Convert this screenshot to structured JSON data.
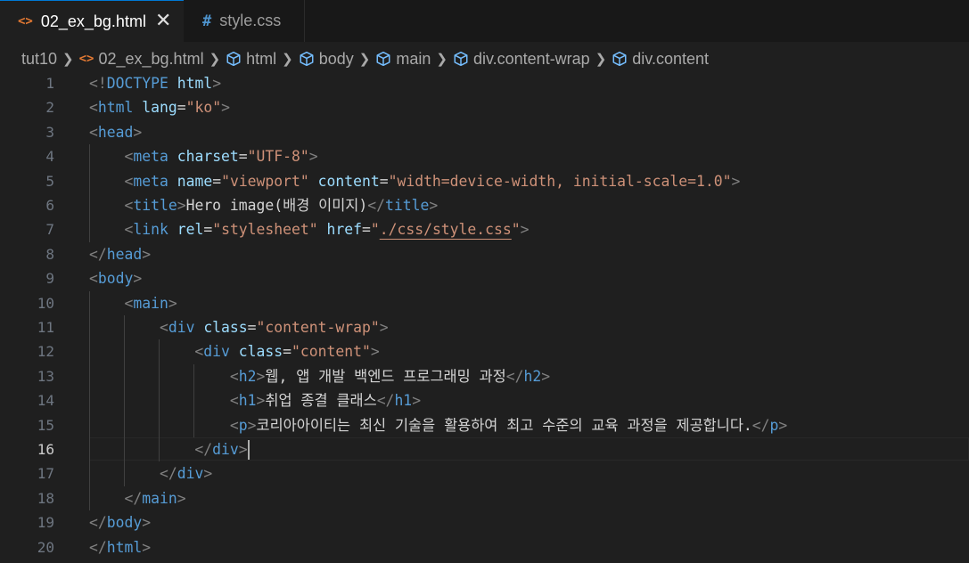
{
  "tabs": [
    {
      "icon": "html-icon",
      "label": "02_ex_bg.html",
      "active": true,
      "close": "✕"
    },
    {
      "icon": "css-hash-icon",
      "label": "style.css",
      "active": false
    }
  ],
  "breadcrumb": {
    "folder": "tut10",
    "file": "02_ex_bg.html",
    "items": [
      "html",
      "body",
      "main",
      "div.content-wrap",
      "div.content"
    ]
  },
  "editor": {
    "current_line": 16,
    "lines": [
      {
        "n": "1",
        "tokens": [
          [
            "p",
            "<!"
          ],
          [
            "t",
            "DOCTYPE"
          ],
          [
            "x",
            " "
          ],
          [
            "a",
            "html"
          ],
          [
            "p",
            ">"
          ]
        ]
      },
      {
        "n": "2",
        "tokens": [
          [
            "p",
            "<"
          ],
          [
            "t",
            "html"
          ],
          [
            "x",
            " "
          ],
          [
            "a",
            "lang"
          ],
          [
            "x",
            "="
          ],
          [
            "s",
            "\"ko\""
          ],
          [
            "p",
            ">"
          ]
        ]
      },
      {
        "n": "3",
        "tokens": [
          [
            "p",
            "<"
          ],
          [
            "t",
            "head"
          ],
          [
            "p",
            ">"
          ]
        ]
      },
      {
        "n": "4",
        "tokens": [
          [
            "x",
            "    "
          ],
          [
            "p",
            "<"
          ],
          [
            "t",
            "meta"
          ],
          [
            "x",
            " "
          ],
          [
            "a",
            "charset"
          ],
          [
            "x",
            "="
          ],
          [
            "s",
            "\"UTF-8\""
          ],
          [
            "p",
            ">"
          ]
        ]
      },
      {
        "n": "5",
        "tokens": [
          [
            "x",
            "    "
          ],
          [
            "p",
            "<"
          ],
          [
            "t",
            "meta"
          ],
          [
            "x",
            " "
          ],
          [
            "a",
            "name"
          ],
          [
            "x",
            "="
          ],
          [
            "s",
            "\"viewport\""
          ],
          [
            "x",
            " "
          ],
          [
            "a",
            "content"
          ],
          [
            "x",
            "="
          ],
          [
            "s",
            "\"width=device-width, initial-scale=1.0\""
          ],
          [
            "p",
            ">"
          ]
        ]
      },
      {
        "n": "6",
        "tokens": [
          [
            "x",
            "    "
          ],
          [
            "p",
            "<"
          ],
          [
            "t",
            "title"
          ],
          [
            "p",
            ">"
          ],
          [
            "x",
            "Hero image(배경 이미지)"
          ],
          [
            "p",
            "</"
          ],
          [
            "t",
            "title"
          ],
          [
            "p",
            ">"
          ]
        ]
      },
      {
        "n": "7",
        "tokens": [
          [
            "x",
            "    "
          ],
          [
            "p",
            "<"
          ],
          [
            "t",
            "link"
          ],
          [
            "x",
            " "
          ],
          [
            "a",
            "rel"
          ],
          [
            "x",
            "="
          ],
          [
            "s",
            "\"stylesheet\""
          ],
          [
            "x",
            " "
          ],
          [
            "a",
            "href"
          ],
          [
            "x",
            "="
          ],
          [
            "s",
            "\""
          ],
          [
            "link",
            "./css/style.css"
          ],
          [
            "s",
            "\""
          ],
          [
            "p",
            ">"
          ]
        ]
      },
      {
        "n": "8",
        "tokens": [
          [
            "p",
            "</"
          ],
          [
            "t",
            "head"
          ],
          [
            "p",
            ">"
          ]
        ]
      },
      {
        "n": "9",
        "tokens": [
          [
            "p",
            "<"
          ],
          [
            "t",
            "body"
          ],
          [
            "p",
            ">"
          ]
        ]
      },
      {
        "n": "10",
        "tokens": [
          [
            "x",
            "    "
          ],
          [
            "p",
            "<"
          ],
          [
            "t",
            "main"
          ],
          [
            "p",
            ">"
          ]
        ]
      },
      {
        "n": "11",
        "tokens": [
          [
            "x",
            "        "
          ],
          [
            "p",
            "<"
          ],
          [
            "t",
            "div"
          ],
          [
            "x",
            " "
          ],
          [
            "a",
            "class"
          ],
          [
            "x",
            "="
          ],
          [
            "s",
            "\"content-wrap\""
          ],
          [
            "p",
            ">"
          ]
        ]
      },
      {
        "n": "12",
        "tokens": [
          [
            "x",
            "            "
          ],
          [
            "p",
            "<"
          ],
          [
            "t",
            "div"
          ],
          [
            "x",
            " "
          ],
          [
            "a",
            "class"
          ],
          [
            "x",
            "="
          ],
          [
            "s",
            "\"content\""
          ],
          [
            "p",
            ">"
          ]
        ]
      },
      {
        "n": "13",
        "tokens": [
          [
            "x",
            "                "
          ],
          [
            "p",
            "<"
          ],
          [
            "t",
            "h2"
          ],
          [
            "p",
            ">"
          ],
          [
            "x",
            "웹, 앱 개발 백엔드 프로그래밍 과정"
          ],
          [
            "p",
            "</"
          ],
          [
            "t",
            "h2"
          ],
          [
            "p",
            ">"
          ]
        ]
      },
      {
        "n": "14",
        "tokens": [
          [
            "x",
            "                "
          ],
          [
            "p",
            "<"
          ],
          [
            "t",
            "h1"
          ],
          [
            "p",
            ">"
          ],
          [
            "x",
            "취업 종결 클래스"
          ],
          [
            "p",
            "</"
          ],
          [
            "t",
            "h1"
          ],
          [
            "p",
            ">"
          ]
        ]
      },
      {
        "n": "15",
        "tokens": [
          [
            "x",
            "                "
          ],
          [
            "p",
            "<"
          ],
          [
            "t",
            "p"
          ],
          [
            "p",
            ">"
          ],
          [
            "x",
            "코리아아이티는 최신 기술을 활용하여 최고 수준의 교육 과정을 제공합니다."
          ],
          [
            "p",
            "</"
          ],
          [
            "t",
            "p"
          ],
          [
            "p",
            ">"
          ]
        ]
      },
      {
        "n": "16",
        "tokens": [
          [
            "x",
            "            "
          ],
          [
            "p",
            "</"
          ],
          [
            "t",
            "div"
          ],
          [
            "p",
            ">"
          ]
        ]
      },
      {
        "n": "17",
        "tokens": [
          [
            "x",
            "        "
          ],
          [
            "p",
            "</"
          ],
          [
            "t",
            "div"
          ],
          [
            "p",
            ">"
          ]
        ]
      },
      {
        "n": "18",
        "tokens": [
          [
            "x",
            "    "
          ],
          [
            "p",
            "</"
          ],
          [
            "t",
            "main"
          ],
          [
            "p",
            ">"
          ]
        ]
      },
      {
        "n": "19",
        "tokens": [
          [
            "p",
            "</"
          ],
          [
            "t",
            "body"
          ],
          [
            "p",
            ">"
          ]
        ]
      },
      {
        "n": "20",
        "tokens": [
          [
            "p",
            "</"
          ],
          [
            "t",
            "html"
          ],
          [
            "p",
            ">"
          ]
        ]
      }
    ]
  },
  "colors": {
    "tag": "#569cd6",
    "attribute": "#9cdcfe",
    "string": "#ce9178",
    "punctuation": "#808080",
    "text": "#d4d4d4",
    "active_tab_border": "#0078d4"
  }
}
